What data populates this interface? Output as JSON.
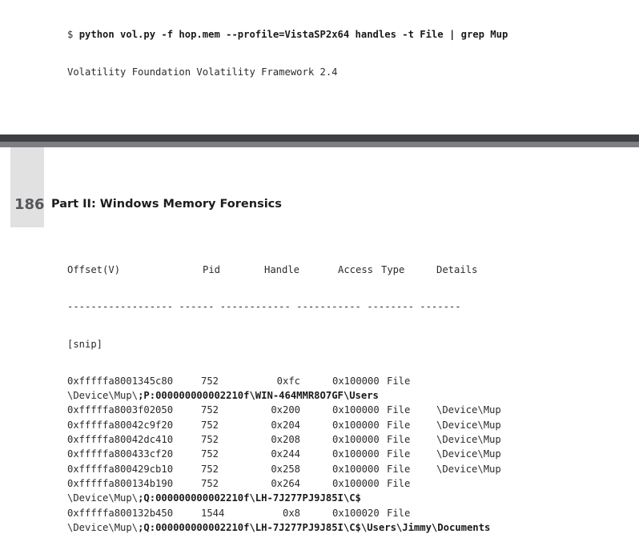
{
  "command": {
    "prompt": "$",
    "text": "python vol.py -f hop.mem --profile=VistaSP2x64 handles -t File | grep Mup",
    "output": "Volatility Foundation Volatility Framework 2.4"
  },
  "page": {
    "number": "186",
    "part_title": "Part II: Windows Memory Forensics"
  },
  "table": {
    "headers": [
      "Offset(V)",
      "Pid",
      "Handle",
      "Access",
      "Type",
      "Details"
    ],
    "separator": "------------------ ------ ------------ ----------- -------- -------",
    "snip": "[snip]",
    "rows": [
      {
        "offset": "0xfffffa8001345c80",
        "pid": "752",
        "handle": "0xfc",
        "access": "0x100000",
        "type": "File",
        "details": "",
        "path_prefix": "\\Device\\Mup\\",
        "path_bold": ";P:000000000002210f\\WIN-464MMR8O7GF\\Users"
      },
      {
        "offset": "0xfffffa8003f02050",
        "pid": "752",
        "handle": "0x200",
        "access": "0x100000",
        "type": "File",
        "details": "\\Device\\Mup"
      },
      {
        "offset": "0xfffffa80042c9f20",
        "pid": "752",
        "handle": "0x204",
        "access": "0x100000",
        "type": "File",
        "details": "\\Device\\Mup"
      },
      {
        "offset": "0xfffffa80042dc410",
        "pid": "752",
        "handle": "0x208",
        "access": "0x100000",
        "type": "File",
        "details": "\\Device\\Mup"
      },
      {
        "offset": "0xfffffa800433cf20",
        "pid": "752",
        "handle": "0x244",
        "access": "0x100000",
        "type": "File",
        "details": "\\Device\\Mup"
      },
      {
        "offset": "0xfffffa800429cb10",
        "pid": "752",
        "handle": "0x258",
        "access": "0x100000",
        "type": "File",
        "details": "\\Device\\Mup"
      },
      {
        "offset": "0xfffffa800134b190",
        "pid": "752",
        "handle": "0x264",
        "access": "0x100000",
        "type": "File",
        "details": "",
        "path_prefix": "\\Device\\Mup\\",
        "path_bold": ";Q:000000000002210f\\LH-7J277PJ9J85I\\C$"
      },
      {
        "offset": "0xfffffa800132b450",
        "pid": "1544",
        "handle": "0x8",
        "access": "0x100020",
        "type": "File",
        "details": "",
        "path_prefix": "\\Device\\Mup\\",
        "path_bold": ";Q:000000000002210f\\LH-7J277PJ9J85I\\C$\\Users\\Jimmy\\Documents"
      }
    ]
  }
}
